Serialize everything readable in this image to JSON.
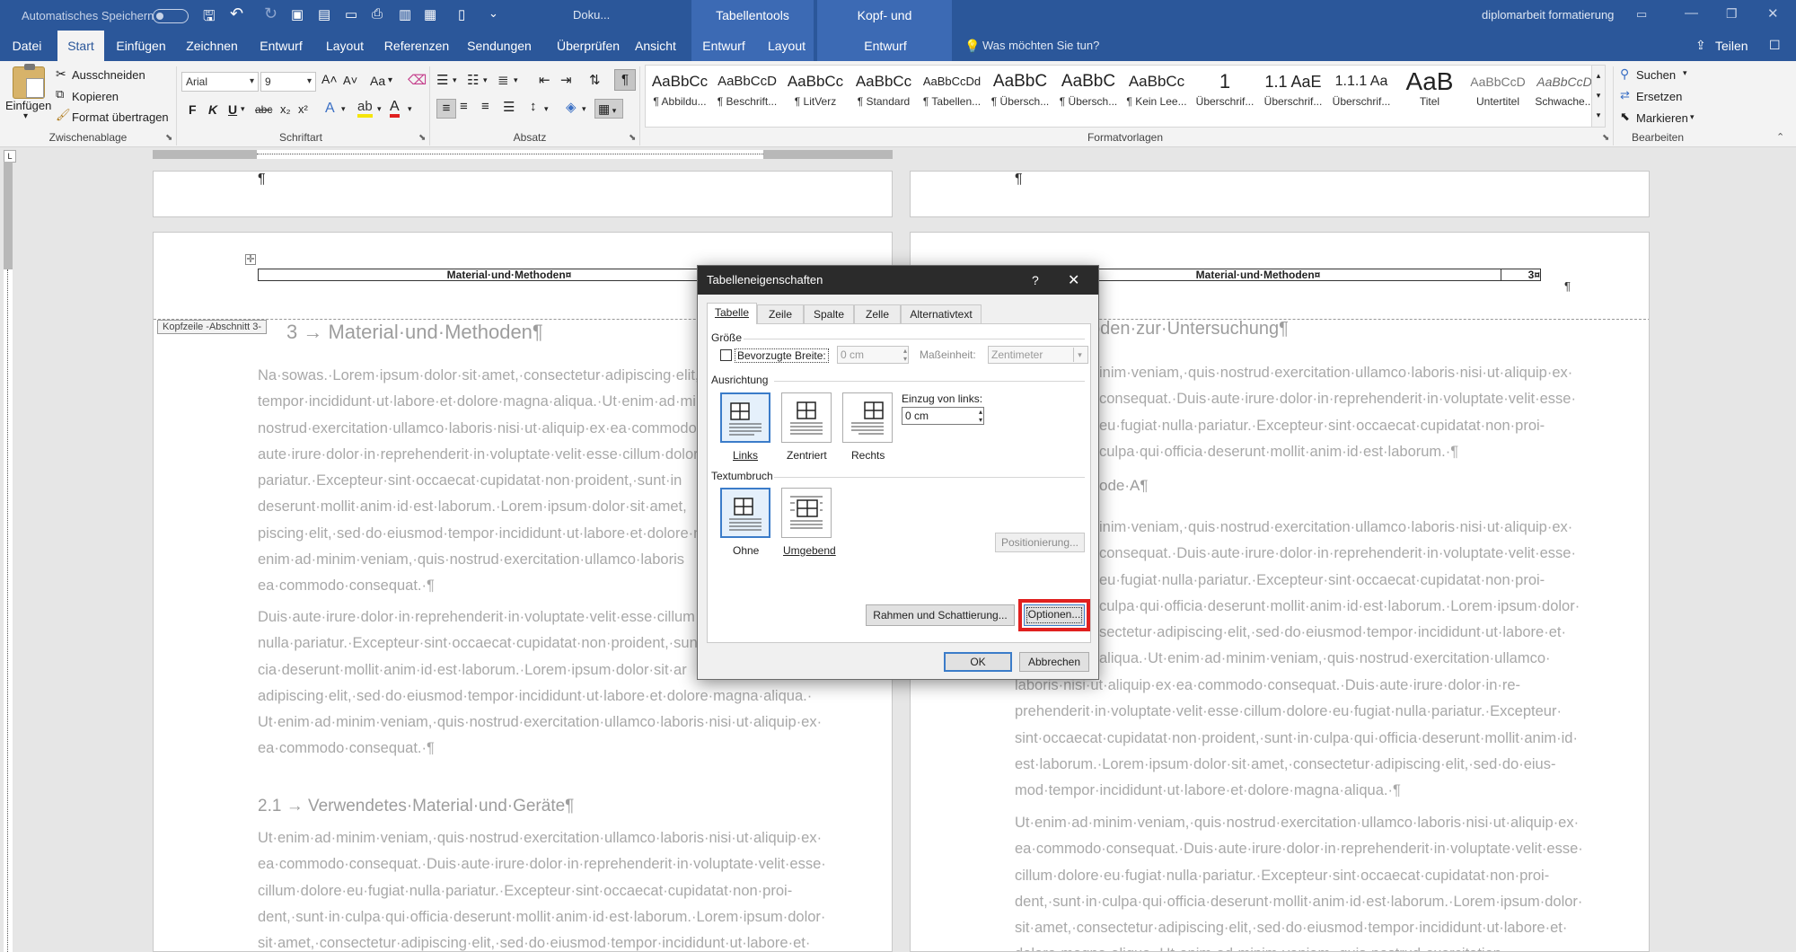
{
  "titlebar": {
    "autosave": "Automatisches Speichern",
    "doc_name": "Doku...",
    "ctx_table": "Tabellentools",
    "ctx_header": "Kopf- und Fußzeilentools",
    "file_title": "diplomarbeit formatierung"
  },
  "tabs": [
    "Datei",
    "Start",
    "Einfügen",
    "Zeichnen",
    "Entwurf",
    "Layout",
    "Referenzen",
    "Sendungen",
    "Überprüfen",
    "Ansicht"
  ],
  "ctx_tabs": [
    "Entwurf",
    "Layout",
    "Entwurf"
  ],
  "tell_me": "Was möchten Sie tun?",
  "share": "Teilen",
  "clipboard": {
    "paste": "Einfügen",
    "cut": "Ausschneiden",
    "copy": "Kopieren",
    "format_painter": "Format übertragen",
    "label": "Zwischenablage"
  },
  "font": {
    "name": "Arial",
    "size": "9",
    "label": "Schriftart",
    "bold": "F",
    "italic": "K",
    "underline": "U",
    "strike": "abc",
    "sub": "x₂",
    "sup": "x²",
    "grow": "A˄",
    "shrink": "A˅",
    "case": "Aa"
  },
  "paragraph": {
    "label": "Absatz"
  },
  "styles": {
    "label": "Formatvorlagen",
    "items": [
      {
        "preview": "AaBbCc",
        "name": "¶ Abbildu..."
      },
      {
        "preview": "AaBbCcD",
        "name": "¶ Beschrift..."
      },
      {
        "preview": "AaBbCc",
        "name": "¶ LitVerz"
      },
      {
        "preview": "AaBbCc",
        "name": "¶ Standard"
      },
      {
        "preview": "AaBbCcDd",
        "name": "¶ Tabellen..."
      },
      {
        "preview": "AaBbC",
        "name": "¶ Übersch..."
      },
      {
        "preview": "AaBbC",
        "name": "¶ Übersch..."
      },
      {
        "preview": "AaBbCc",
        "name": "¶ Kein Lee..."
      },
      {
        "preview": "1",
        "name": "Überschrif..."
      },
      {
        "preview": "1.1 AaE",
        "name": "Überschrif..."
      },
      {
        "preview": "1.1.1 Aa",
        "name": "Überschrif..."
      },
      {
        "preview": "AaB",
        "name": "Titel"
      },
      {
        "preview": "AaBbCcD",
        "name": "Untertitel"
      },
      {
        "preview": "AaBbCcD",
        "name": "Schwache..."
      }
    ]
  },
  "editing": {
    "label": "Bearbeiten",
    "find": "Suchen",
    "replace": "Ersetzen",
    "select": "Markieren"
  },
  "document": {
    "pilcrow": "¶",
    "header_title": "Material·und·Methoden¤",
    "header_title_right": "Material·und·Methoden¤",
    "page_num": "3¤",
    "header_tag": "Kopfzeile -Abschnitt 3-",
    "h1": "3 → Material·und·Methoden¶",
    "left_para1": [
      "Na·sowas.·Lorem·ipsum·dolor·sit·amet,·consectetur·adipiscing·elit,",
      "tempor·incididunt·ut·labore·et·dolore·magna·aliqua.·Ut·enim·ad·min",
      "nostrud·exercitation·ullamco·laboris·nisi·ut·aliquip·ex·ea·commodo",
      "aute·irure·dolor·in·reprehenderit·in·voluptate·velit·esse·cillum·dolor",
      "pariatur.·Excepteur·sint·occaecat·cupidatat·non·proident,·sunt·in",
      "deserunt·mollit·anim·id·est·laborum.·Lorem·ipsum·dolor·sit·amet,",
      "piscing·elit,·sed·do·eiusmod·tempor·incididunt·ut·labore·et·dolore·n",
      "enim·ad·minim·veniam,·quis·nostrud·exercitation·ullamco·laboris",
      "ea·commodo·consequat.·¶"
    ],
    "left_para2": [
      "Duis·aute·irure·dolor·in·reprehenderit·in·voluptate·velit·esse·cillum",
      "nulla·pariatur.·Excepteur·sint·occaecat·cupidatat·non·proident,·sunt",
      "cia·deserunt·mollit·anim·id·est·laborum.·Lorem·ipsum·dolor·sit·ar",
      "adipiscing·elit,·sed·do·eiusmod·tempor·incididunt·ut·labore·et·dolore·magna·aliqua.·",
      "Ut·enim·ad·minim·veniam,·quis·nostrud·exercitation·ullamco·laboris·nisi·ut·aliquip·ex·",
      "ea·commodo·consequat.·¶"
    ],
    "h2": "2.1 → Verwendetes·Material·und·Geräte¶",
    "left_para3": [
      "Ut·enim·ad·minim·veniam,·quis·nostrud·exercitation·ullamco·laboris·nisi·ut·aliquip·ex·",
      "ea·commodo·consequat.·Duis·aute·irure·dolor·in·reprehenderit·in·voluptate·velit·esse·",
      "cillum·dolore·eu·fugiat·nulla·pariatur.·Excepteur·sint·occaecat·cupidatat·non·proi-",
      "dent,·sunt·in·culpa·qui·officia·deserunt·mollit·anim·id·est·laborum.·Lorem·ipsum·dolor·",
      "sit·amet,·consectetur·adipiscing·elit,·sed·do·eiusmod·tempor·incididunt·ut·labore·et·"
    ],
    "right_h": "oden·zur·Untersuchung¶",
    "right_para1": [
      "inim·veniam,·quis·nostrud·exercitation·ullamco·laboris·nisi·ut·aliquip·ex·",
      "consequat.·Duis·aute·irure·dolor·in·reprehenderit·in·voluptate·velit·esse·",
      "eu·fugiat·nulla·pariatur.·Excepteur·sint·occaecat·cupidatat·non·proi-",
      "culpa·qui·officia·deserunt·mollit·anim·id·est·laborum.·¶"
    ],
    "right_h2": "ode·A¶",
    "right_para2": [
      "inim·veniam,·quis·nostrud·exercitation·ullamco·laboris·nisi·ut·aliquip·ex·",
      "consequat.·Duis·aute·irure·dolor·in·reprehenderit·in·voluptate·velit·esse·",
      "eu·fugiat·nulla·pariatur.·Excepteur·sint·occaecat·cupidatat·non·proi-",
      "culpa·qui·officia·deserunt·mollit·anim·id·est·laborum.·Lorem·ipsum·dolor·",
      "sectetur·adipiscing·elit,·sed·do·eiusmod·tempor·incididunt·ut·labore·et·",
      "aliqua.·Ut·enim·ad·minim·veniam,·quis·nostrud·exercitation·ullamco·",
      "laboris·nisi·ut·aliquip·ex·ea·commodo·consequat.·Duis·aute·irure·dolor·in·re-",
      "prehenderit·in·voluptate·velit·esse·cillum·dolore·eu·fugiat·nulla·pariatur.·Excepteur·",
      "sint·occaecat·cupidatat·non·proident,·sunt·in·culpa·qui·officia·deserunt·mollit·anim·id·",
      "est·laborum.·Lorem·ipsum·dolor·sit·amet,·consectetur·adipiscing·elit,·sed·do·eius-",
      "mod·tempor·incididunt·ut·labore·et·dolore·magna·aliqua.·¶"
    ],
    "right_para3": [
      "Ut·enim·ad·minim·veniam,·quis·nostrud·exercitation·ullamco·laboris·nisi·ut·aliquip·ex·",
      "ea·commodo·consequat.·Duis·aute·irure·dolor·in·reprehenderit·in·voluptate·velit·esse·",
      "cillum·dolore·eu·fugiat·nulla·pariatur.·Excepteur·sint·occaecat·cupidatat·non·proi-",
      "dent,·sunt·in·culpa·qui·officia·deserunt·mollit·anim·id·est·laborum.·Lorem·ipsum·dolor·",
      "sit·amet,·consectetur·adipiscing·elit,·sed·do·eiusmod·tempor·incididunt·ut·labore·et·",
      "dolore·magna·aliqua.·Ut·enim·ad·minim·veniam,·quis·nostrud·exercitation·"
    ]
  },
  "dialog": {
    "title": "Tabelleneigenschaften",
    "help": "?",
    "tabs": [
      "Tabelle",
      "Zeile",
      "Spalte",
      "Zelle",
      "Alternativtext"
    ],
    "size_label": "Größe",
    "pref_width": "Bevorzugte Breite:",
    "width_value": "0 cm",
    "unit_label": "Maßeinheit:",
    "unit_value": "Zentimeter",
    "align_label": "Ausrichtung",
    "align_left": "Links",
    "align_center": "Zentriert",
    "align_right": "Rechts",
    "indent_label": "Einzug von links:",
    "indent_value": "0 cm",
    "wrap_label": "Textumbruch",
    "wrap_none": "Ohne",
    "wrap_around": "Umgebend",
    "positioning": "Positionierung...",
    "borders": "Rahmen und Schattierung...",
    "options": "Optionen...",
    "ok": "OK",
    "cancel": "Abbrechen"
  },
  "colors": {
    "brand": "#2b579a",
    "highlight": "#e0201f"
  }
}
